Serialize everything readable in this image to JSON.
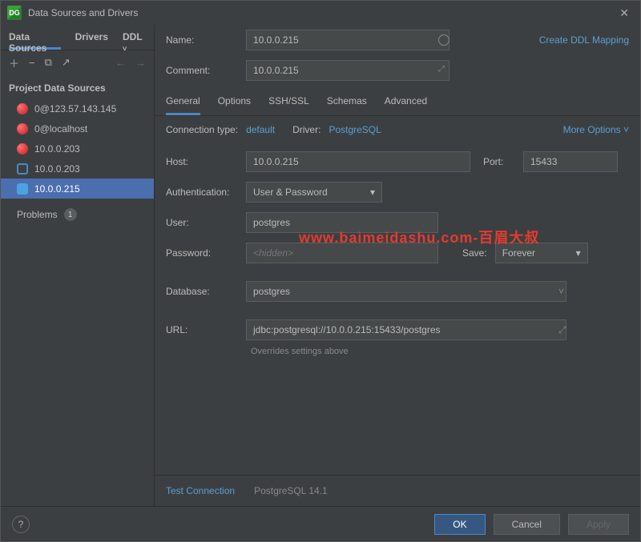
{
  "title": "Data Sources and Drivers",
  "sidebar": {
    "tabs": [
      "Data Sources",
      "Drivers",
      "DDL"
    ],
    "section": "Project Data Sources",
    "items": [
      {
        "label": "0@123.57.143.145",
        "icon": "red"
      },
      {
        "label": "0@localhost",
        "icon": "red"
      },
      {
        "label": "10.0.0.203",
        "icon": "red"
      },
      {
        "label": "10.0.0.203",
        "icon": "blue-out"
      },
      {
        "label": "10.0.0.215",
        "icon": "elephant"
      }
    ],
    "problems_label": "Problems",
    "problems_count": "1"
  },
  "form": {
    "name_label": "Name:",
    "name_value": "10.0.0.215",
    "ddl_link": "Create DDL Mapping",
    "comment_label": "Comment:",
    "comment_value": "10.0.0.215"
  },
  "tabs": [
    "General",
    "Options",
    "SSH/SSL",
    "Schemas",
    "Advanced"
  ],
  "general": {
    "conn_type_label": "Connection type:",
    "conn_type_value": "default",
    "driver_label": "Driver:",
    "driver_value": "PostgreSQL",
    "more_options": "More Options",
    "host_label": "Host:",
    "host_value": "10.0.0.215",
    "port_label": "Port:",
    "port_value": "15433",
    "auth_label": "Authentication:",
    "auth_value": "User & Password",
    "user_label": "User:",
    "user_value": "postgres",
    "password_label": "Password:",
    "password_placeholder": "<hidden>",
    "save_label": "Save:",
    "save_value": "Forever",
    "database_label": "Database:",
    "database_value": "postgres",
    "url_label": "URL:",
    "url_value": "jdbc:postgresql://10.0.0.215:15433/postgres",
    "overrides": "Overrides settings above"
  },
  "watermark": "www.baimeidashu.com-百眉大叔",
  "bottom": {
    "test": "Test Connection",
    "driver_version": "PostgreSQL 14.1"
  },
  "footer": {
    "ok": "OK",
    "cancel": "Cancel",
    "apply": "Apply"
  }
}
